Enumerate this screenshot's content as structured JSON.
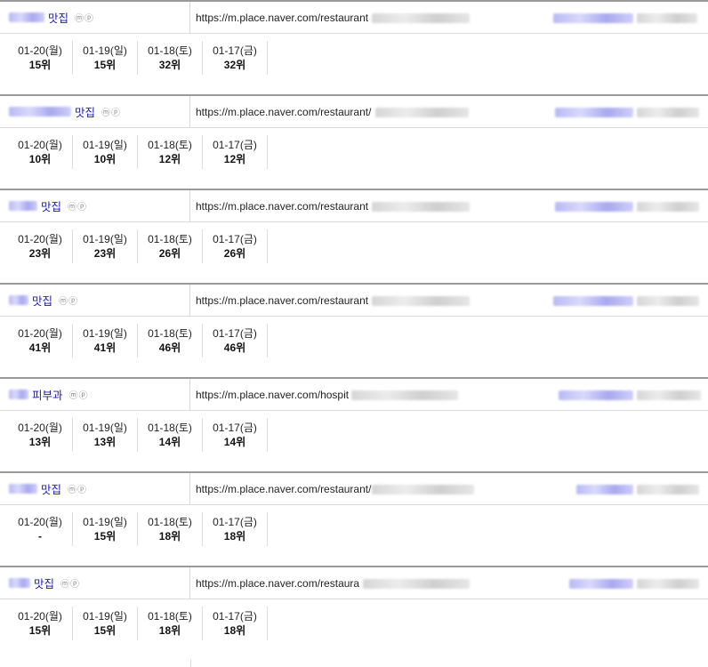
{
  "rows": [
    {
      "keyword": "맛집",
      "icons": "ⓜⓟ",
      "url": "https://m.place.naver.com/restaurant",
      "ranks": [
        {
          "date": "01-20(월)",
          "rank": "15위"
        },
        {
          "date": "01-19(일)",
          "rank": "15위"
        },
        {
          "date": "01-18(토)",
          "rank": "32위"
        },
        {
          "date": "01-17(금)",
          "rank": "32위"
        }
      ]
    },
    {
      "keyword": "맛집",
      "icons": "ⓜⓟ",
      "url": "https://m.place.naver.com/restaurant/",
      "ranks": [
        {
          "date": "01-20(월)",
          "rank": "10위"
        },
        {
          "date": "01-19(일)",
          "rank": "10위"
        },
        {
          "date": "01-18(토)",
          "rank": "12위"
        },
        {
          "date": "01-17(금)",
          "rank": "12위"
        }
      ]
    },
    {
      "keyword": "맛집",
      "icons": "ⓜⓟ",
      "url": "https://m.place.naver.com/restaurant",
      "ranks": [
        {
          "date": "01-20(월)",
          "rank": "23위"
        },
        {
          "date": "01-19(일)",
          "rank": "23위"
        },
        {
          "date": "01-18(토)",
          "rank": "26위"
        },
        {
          "date": "01-17(금)",
          "rank": "26위"
        }
      ]
    },
    {
      "keyword": "맛집",
      "icons": "ⓜⓟ",
      "url": "https://m.place.naver.com/restaurant",
      "ranks": [
        {
          "date": "01-20(월)",
          "rank": "41위"
        },
        {
          "date": "01-19(일)",
          "rank": "41위"
        },
        {
          "date": "01-18(토)",
          "rank": "46위"
        },
        {
          "date": "01-17(금)",
          "rank": "46위"
        }
      ]
    },
    {
      "keyword": "피부과",
      "icons": "ⓜⓟ",
      "url": "https://m.place.naver.com/hospit",
      "ranks": [
        {
          "date": "01-20(월)",
          "rank": "13위"
        },
        {
          "date": "01-19(일)",
          "rank": "13위"
        },
        {
          "date": "01-18(토)",
          "rank": "14위"
        },
        {
          "date": "01-17(금)",
          "rank": "14위"
        }
      ]
    },
    {
      "keyword": "맛집",
      "icons": "ⓜⓟ",
      "url": "https://m.place.naver.com/restaurant/",
      "ranks": [
        {
          "date": "01-20(월)",
          "rank": "-"
        },
        {
          "date": "01-19(일)",
          "rank": "15위"
        },
        {
          "date": "01-18(토)",
          "rank": "18위"
        },
        {
          "date": "01-17(금)",
          "rank": "18위"
        }
      ]
    },
    {
      "keyword": "맛집",
      "icons": "ⓜⓟ",
      "url": "https://m.place.naver.com/restaura",
      "ranks": [
        {
          "date": "01-20(월)",
          "rank": "15위"
        },
        {
          "date": "01-19(일)",
          "rank": "15위"
        },
        {
          "date": "01-18(토)",
          "rank": "18위"
        },
        {
          "date": "01-17(금)",
          "rank": "18위"
        }
      ]
    }
  ]
}
